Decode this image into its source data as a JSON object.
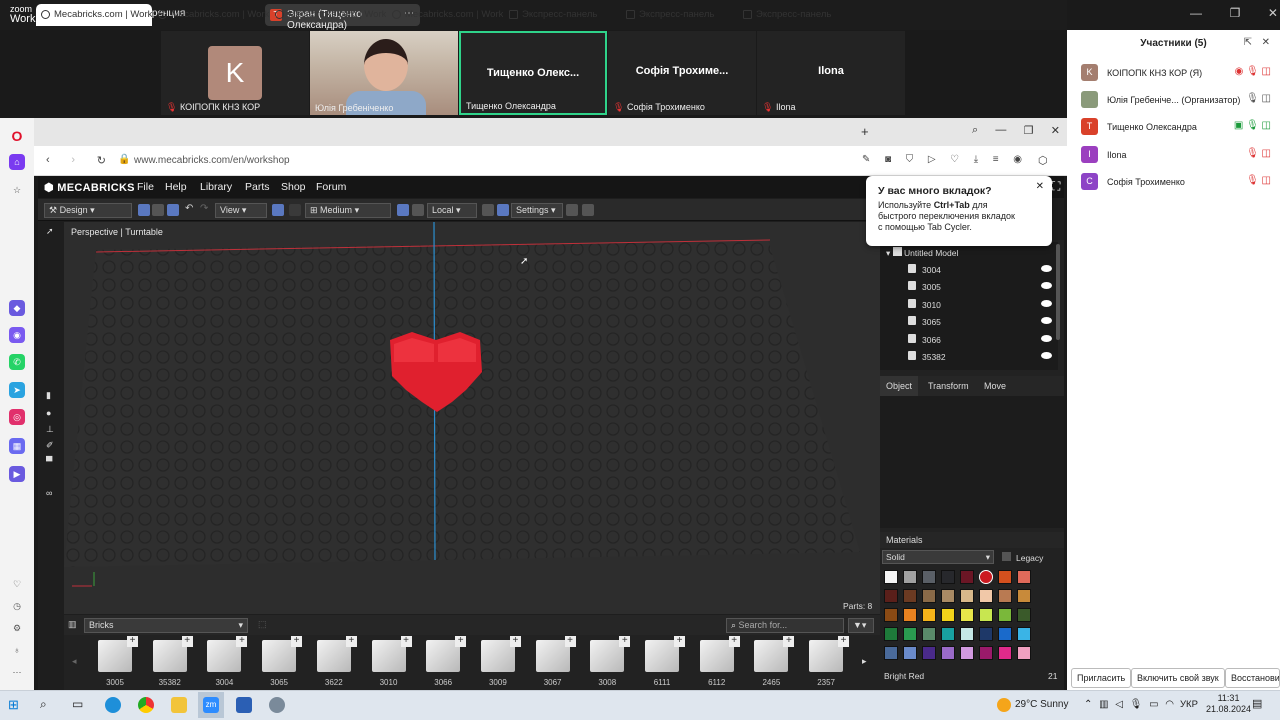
{
  "zoom": {
    "logo_small": "zoom",
    "logo_big": "Workplace",
    "conference": "Конференция",
    "share_label": "Экран (Тищенко Олександра)",
    "share_badge": "T"
  },
  "gallery": [
    {
      "name": "КОІПОПК КНЗ КОР",
      "initial": "K"
    },
    {
      "name": "Юлія Гребеніченко"
    },
    {
      "name": "Тищенко Олександра",
      "display": "Тищенко Олекс..."
    },
    {
      "name": "Софія Трохименко",
      "display": "Софія Трохиме..."
    },
    {
      "name": "Ilona",
      "display": "Ilona"
    }
  ],
  "panel": {
    "title": "Участники (5)",
    "participants": [
      {
        "initial": "K",
        "name": "КОІПОПК КНЗ КОР (Я)",
        "color": "#a47e6f"
      },
      {
        "initial": "",
        "name": "Юлія Гребеніче...  (Организатор)",
        "color": "#777"
      },
      {
        "initial": "T",
        "name": "Тищенко Олександра",
        "color": "#d9412a"
      },
      {
        "initial": "I",
        "name": "Ilona",
        "color": "#9b3fbf"
      },
      {
        "initial": "C",
        "name": "Софія Трохименко",
        "color": "#8d44c6"
      }
    ],
    "buttons": [
      "Пригласить",
      "Включить свой звук",
      "Восстановит"
    ]
  },
  "browser": {
    "tabs": [
      "Mecabricks.com | Worksh",
      "Mecabricks.com | Worksh",
      "Mecabricks.com | Worksh",
      "Mecabricks.com | Worksh",
      "Экспресс-панель",
      "Экспресс-панель",
      "Экспресс-панель"
    ],
    "url": "www.mecabricks.com/en/workshop"
  },
  "popup": {
    "title": "У вас много вкладок?",
    "line1": "Используйте",
    "bold": "Ctrl+Tab",
    "line1b": "для",
    "line2": "быстрого переключения вкладок",
    "line3": "с помощью Tab Cycler."
  },
  "app": {
    "logo": "MECABRICKS",
    "menu": [
      "File",
      "Help",
      "Library",
      "Parts",
      "Shop",
      "Forum"
    ],
    "toolbar": {
      "mode": "Design",
      "view": "View",
      "quality": "Medium",
      "space": "Local",
      "settings": "Settings"
    },
    "viewport_label": "Perspective | Turntable",
    "parts_count": "Parts: 8",
    "category": "Bricks",
    "search_placeholder": "Search for...",
    "parts": [
      "3005",
      "35382",
      "3004",
      "3065",
      "3622",
      "3010",
      "3066",
      "3009",
      "3067",
      "3008",
      "6111",
      "6112",
      "2465",
      "2357"
    ],
    "tree": {
      "root": "Untitled Model",
      "items": [
        "3004",
        "3005",
        "3010",
        "3065",
        "3066",
        "35382"
      ]
    },
    "obj_tabs": [
      "Object",
      "Transform",
      "Move"
    ],
    "materials": {
      "title": "Materials",
      "type": "Solid",
      "legacy": "Legacy",
      "selected": "Bright Red",
      "selected_count": "21",
      "swatches": [
        "#f4f4f4",
        "#a0a0a0",
        "#5a5f66",
        "#27282c",
        "#6b1625",
        "#cc1a20",
        "#d4501e",
        "#e06a5a",
        "#5a1f1a",
        "#6b3a22",
        "#8a6a48",
        "#a98a64",
        "#d8b88a",
        "#f1c8a8",
        "#b97a52",
        "#c88a3a",
        "#8a4a14",
        "#e88220",
        "#f5b31a",
        "#f2d21a",
        "#e8e64a",
        "#c8e650",
        "#7ab83a",
        "#3a5a2a",
        "#1e7a3a",
        "#2a9a50",
        "#5a8a6a",
        "#18a0a0",
        "#c6e8e6",
        "#1e3868",
        "#1a6acb",
        "#3ab4e6",
        "#4a6a9a",
        "#6a8aca",
        "#4a2a8a",
        "#9a6ac8",
        "#d29ae0",
        "#9a1a6a",
        "#e02a8a",
        "#f0a0c0"
      ]
    }
  },
  "taskbar": {
    "weather": "29°C  Sunny",
    "lang": "УКР",
    "time": "11:31",
    "date": "21.08.2024"
  }
}
